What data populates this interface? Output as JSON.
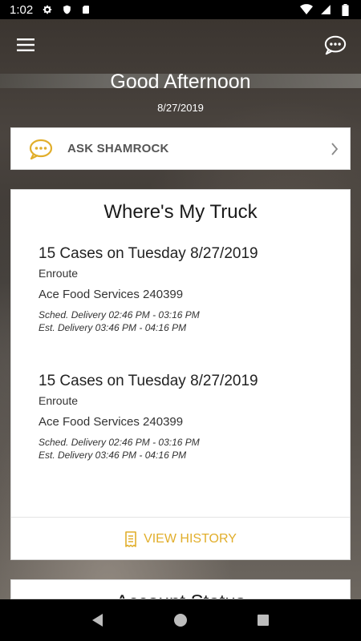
{
  "status_bar": {
    "time": "1:02",
    "left_icons": [
      "gear-icon",
      "shield-icon",
      "sd-card-icon"
    ],
    "right_icons": [
      "wifi-icon",
      "signal-icon",
      "battery-icon"
    ]
  },
  "app_bar": {
    "menu_icon": "menu-icon",
    "chat_icon": "chat-bubble-icon"
  },
  "header": {
    "greeting": "Good Afternoon",
    "date": "8/27/2019"
  },
  "ask_card": {
    "label": "ASK SHAMROCK",
    "icon": "chat-bubble-icon",
    "accent": "#e1ae2b"
  },
  "truck_card": {
    "title": "Where's My Truck",
    "deliveries": [
      {
        "title": "15 Cases on Tuesday 8/27/2019",
        "status": "Enroute",
        "customer": "Ace Food Services 240399",
        "scheduled": "Sched. Delivery 02:46 PM - 03:16 PM",
        "estimated": "Est. Delivery 03:46 PM - 04:16 PM"
      },
      {
        "title": "15 Cases on Tuesday 8/27/2019",
        "status": "Enroute",
        "customer": "Ace Food Services 240399",
        "scheduled": "Sched. Delivery 02:46 PM - 03:16 PM",
        "estimated": "Est. Delivery 03:46 PM - 04:16 PM"
      }
    ],
    "history_label": "VIEW HISTORY"
  },
  "account_card": {
    "title": "Account Status"
  },
  "nav_bar": {
    "icons": [
      "back-icon",
      "home-icon",
      "recents-icon"
    ]
  }
}
